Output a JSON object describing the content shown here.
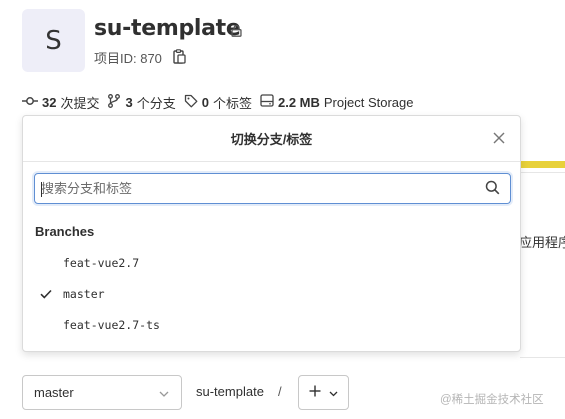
{
  "project": {
    "avatar_letter": "S",
    "name": "su-template",
    "id_label": "项目ID: 870"
  },
  "stats": {
    "commits_count": "32",
    "commits_label": "次提交",
    "branches_count": "3",
    "branches_label": "个分支",
    "tags_count": "0",
    "tags_label": "个标签",
    "storage_size": "2.2 MB",
    "storage_label": "Project Storage"
  },
  "background": {
    "partial_text": "应用程序"
  },
  "dropdown": {
    "title": "切换分支/标签",
    "search_placeholder": "搜索分支和标签",
    "section_header": "Branches",
    "branches": [
      {
        "name": "feat-vue2.7",
        "selected": false
      },
      {
        "name": "master",
        "selected": true
      },
      {
        "name": "feat-vue2.7-ts",
        "selected": false
      }
    ]
  },
  "toolbar": {
    "branch_select_value": "master",
    "path_crumb": "su-template",
    "path_separator": "/",
    "add_button_label": "+"
  },
  "watermark": "@稀土掘金技术社区",
  "colors": {
    "accent_focus": "#5f8fd3",
    "avatar_bg": "#eeeef8",
    "progress_yellow": "#e8d13a"
  },
  "icons": {
    "lock": "lock-icon",
    "copy": "copy-icon",
    "commit": "commit-icon",
    "branch": "branch-icon",
    "tag": "tag-icon",
    "storage": "storage-icon",
    "close": "close-icon",
    "search": "search-icon",
    "check": "check-icon",
    "chevron": "chevron-down-icon"
  }
}
